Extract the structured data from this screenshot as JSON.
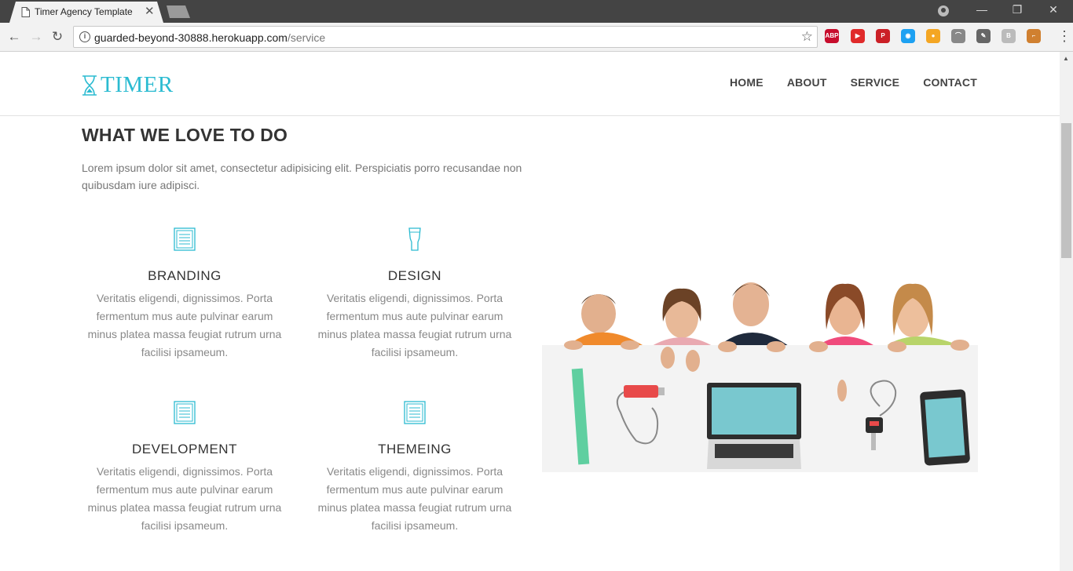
{
  "browser": {
    "tab_title": "Timer Agency Template",
    "url_host": "guarded-beyond-30888.herokuapp.com",
    "url_path": "/service",
    "extensions": [
      {
        "name": "adblock-plus-icon",
        "label": "ABP",
        "color": "#c70d2c"
      },
      {
        "name": "video-ext-icon",
        "label": "▶",
        "color": "#e02a2a"
      },
      {
        "name": "pinterest-icon",
        "label": "P",
        "color": "#cb2027"
      },
      {
        "name": "eye-ext-icon",
        "label": "◉",
        "color": "#1da1f2"
      },
      {
        "name": "bulb-ext-icon",
        "label": "●",
        "color": "#f4a623"
      },
      {
        "name": "rainbow-ext-icon",
        "label": "⌒",
        "color": "#888888"
      },
      {
        "name": "eyedropper-ext-icon",
        "label": "✎",
        "color": "#666666"
      },
      {
        "name": "b-ext-icon",
        "label": "B",
        "color": "#bbbbbb"
      },
      {
        "name": "ruler-ext-icon",
        "label": "⌐",
        "color": "#d08030"
      }
    ]
  },
  "site": {
    "logo_text": "TIMER",
    "brand_color": "#2bbbd1",
    "nav": [
      "HOME",
      "ABOUT",
      "SERVICE",
      "CONTACT"
    ]
  },
  "section": {
    "title": "WHAT WE LOVE TO DO",
    "description": "Lorem ipsum dolor sit amet, consectetur adipisicing elit. Perspiciatis porro recusandae non quibusdam iure adipisci."
  },
  "services": [
    {
      "title": "BRANDING",
      "icon": "document-icon",
      "text": "Veritatis eligendi, dignissimos. Porta fermentum mus aute pulvinar earum minus platea massa feugiat rutrum urna facilisi ipsameum."
    },
    {
      "title": "DESIGN",
      "icon": "glass-icon",
      "text": "Veritatis eligendi, dignissimos. Porta fermentum mus aute pulvinar earum minus platea massa feugiat rutrum urna facilisi ipsameum."
    },
    {
      "title": "DEVELOPMENT",
      "icon": "document-icon",
      "text": "Veritatis eligendi, dignissimos. Porta fermentum mus aute pulvinar earum minus platea massa feugiat rutrum urna facilisi ipsameum."
    },
    {
      "title": "THEMEING",
      "icon": "document-icon",
      "text": "Veritatis eligendi, dignissimos. Porta fermentum mus aute pulvinar earum minus platea massa feugiat rutrum urna facilisi ipsameum."
    }
  ]
}
